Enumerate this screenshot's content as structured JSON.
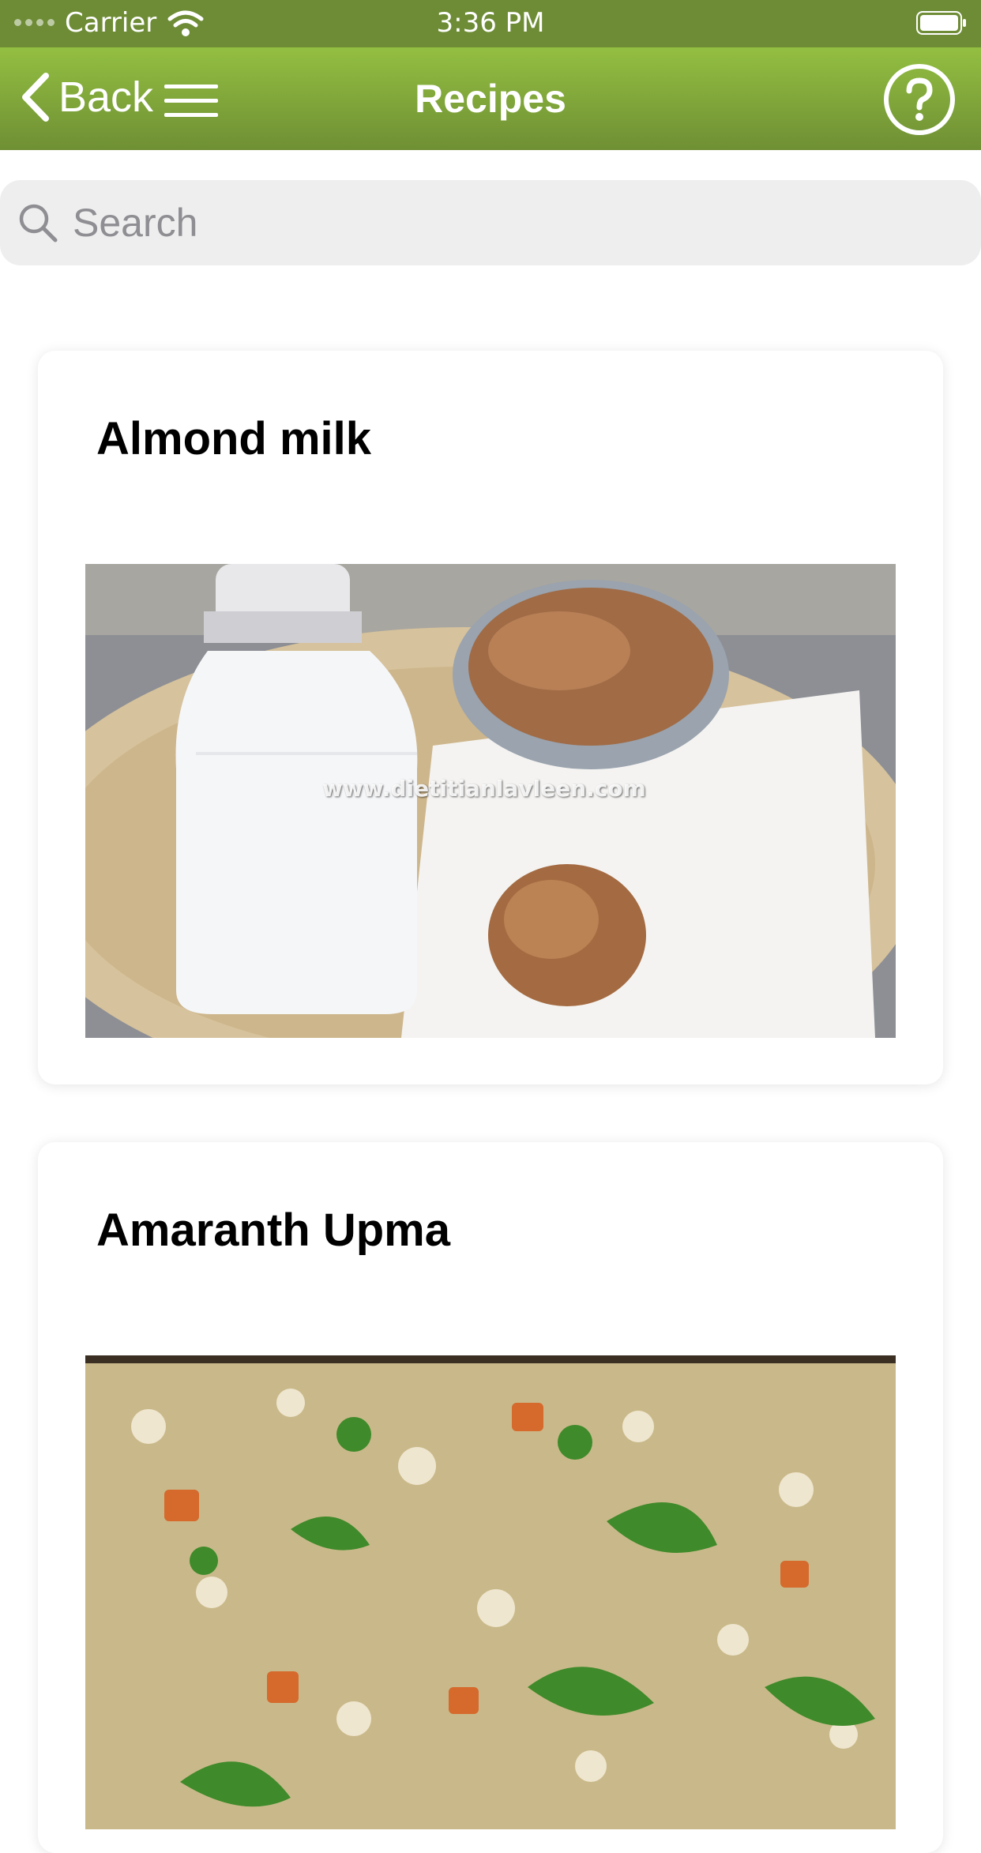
{
  "status_bar": {
    "carrier": "Carrier",
    "time": "3:36 PM"
  },
  "nav": {
    "back_label": "Back",
    "title": "Recipes"
  },
  "search": {
    "placeholder": "Search",
    "value": ""
  },
  "recipes": [
    {
      "title": "Almond milk",
      "watermark": "www.dietitianlavleen.com"
    },
    {
      "title": "Amaranth Upma"
    }
  ],
  "colors": {
    "nav_top": "#93bf41",
    "nav_bottom": "#6f8f34",
    "status_bar": "#6e8c36",
    "search_bg": "#eeeeee"
  }
}
